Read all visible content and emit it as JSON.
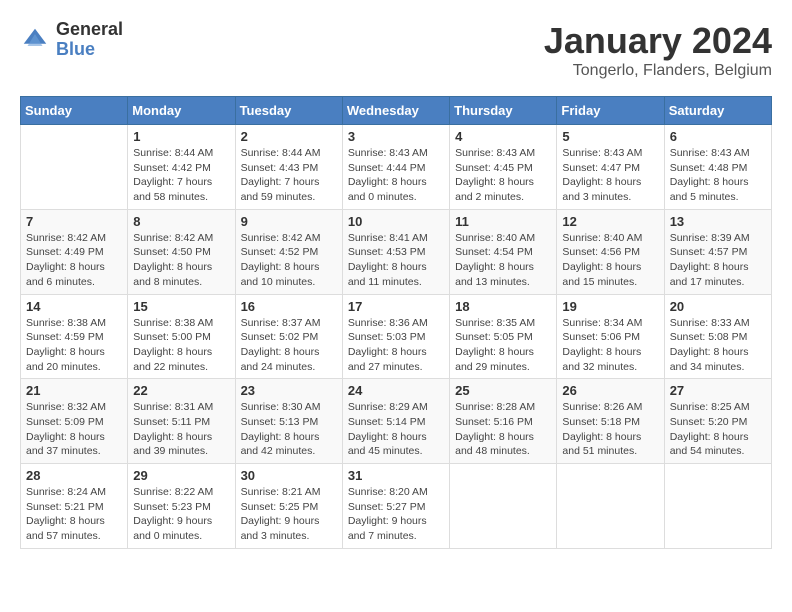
{
  "header": {
    "logo_general": "General",
    "logo_blue": "Blue",
    "month_title": "January 2024",
    "location": "Tongerlo, Flanders, Belgium"
  },
  "days_of_week": [
    "Sunday",
    "Monday",
    "Tuesday",
    "Wednesday",
    "Thursday",
    "Friday",
    "Saturday"
  ],
  "weeks": [
    [
      {
        "day": "",
        "info": ""
      },
      {
        "day": "1",
        "info": "Sunrise: 8:44 AM\nSunset: 4:42 PM\nDaylight: 7 hours\nand 58 minutes."
      },
      {
        "day": "2",
        "info": "Sunrise: 8:44 AM\nSunset: 4:43 PM\nDaylight: 7 hours\nand 59 minutes."
      },
      {
        "day": "3",
        "info": "Sunrise: 8:43 AM\nSunset: 4:44 PM\nDaylight: 8 hours\nand 0 minutes."
      },
      {
        "day": "4",
        "info": "Sunrise: 8:43 AM\nSunset: 4:45 PM\nDaylight: 8 hours\nand 2 minutes."
      },
      {
        "day": "5",
        "info": "Sunrise: 8:43 AM\nSunset: 4:47 PM\nDaylight: 8 hours\nand 3 minutes."
      },
      {
        "day": "6",
        "info": "Sunrise: 8:43 AM\nSunset: 4:48 PM\nDaylight: 8 hours\nand 5 minutes."
      }
    ],
    [
      {
        "day": "7",
        "info": "Sunrise: 8:42 AM\nSunset: 4:49 PM\nDaylight: 8 hours\nand 6 minutes."
      },
      {
        "day": "8",
        "info": "Sunrise: 8:42 AM\nSunset: 4:50 PM\nDaylight: 8 hours\nand 8 minutes."
      },
      {
        "day": "9",
        "info": "Sunrise: 8:42 AM\nSunset: 4:52 PM\nDaylight: 8 hours\nand 10 minutes."
      },
      {
        "day": "10",
        "info": "Sunrise: 8:41 AM\nSunset: 4:53 PM\nDaylight: 8 hours\nand 11 minutes."
      },
      {
        "day": "11",
        "info": "Sunrise: 8:40 AM\nSunset: 4:54 PM\nDaylight: 8 hours\nand 13 minutes."
      },
      {
        "day": "12",
        "info": "Sunrise: 8:40 AM\nSunset: 4:56 PM\nDaylight: 8 hours\nand 15 minutes."
      },
      {
        "day": "13",
        "info": "Sunrise: 8:39 AM\nSunset: 4:57 PM\nDaylight: 8 hours\nand 17 minutes."
      }
    ],
    [
      {
        "day": "14",
        "info": "Sunrise: 8:38 AM\nSunset: 4:59 PM\nDaylight: 8 hours\nand 20 minutes."
      },
      {
        "day": "15",
        "info": "Sunrise: 8:38 AM\nSunset: 5:00 PM\nDaylight: 8 hours\nand 22 minutes."
      },
      {
        "day": "16",
        "info": "Sunrise: 8:37 AM\nSunset: 5:02 PM\nDaylight: 8 hours\nand 24 minutes."
      },
      {
        "day": "17",
        "info": "Sunrise: 8:36 AM\nSunset: 5:03 PM\nDaylight: 8 hours\nand 27 minutes."
      },
      {
        "day": "18",
        "info": "Sunrise: 8:35 AM\nSunset: 5:05 PM\nDaylight: 8 hours\nand 29 minutes."
      },
      {
        "day": "19",
        "info": "Sunrise: 8:34 AM\nSunset: 5:06 PM\nDaylight: 8 hours\nand 32 minutes."
      },
      {
        "day": "20",
        "info": "Sunrise: 8:33 AM\nSunset: 5:08 PM\nDaylight: 8 hours\nand 34 minutes."
      }
    ],
    [
      {
        "day": "21",
        "info": "Sunrise: 8:32 AM\nSunset: 5:09 PM\nDaylight: 8 hours\nand 37 minutes."
      },
      {
        "day": "22",
        "info": "Sunrise: 8:31 AM\nSunset: 5:11 PM\nDaylight: 8 hours\nand 39 minutes."
      },
      {
        "day": "23",
        "info": "Sunrise: 8:30 AM\nSunset: 5:13 PM\nDaylight: 8 hours\nand 42 minutes."
      },
      {
        "day": "24",
        "info": "Sunrise: 8:29 AM\nSunset: 5:14 PM\nDaylight: 8 hours\nand 45 minutes."
      },
      {
        "day": "25",
        "info": "Sunrise: 8:28 AM\nSunset: 5:16 PM\nDaylight: 8 hours\nand 48 minutes."
      },
      {
        "day": "26",
        "info": "Sunrise: 8:26 AM\nSunset: 5:18 PM\nDaylight: 8 hours\nand 51 minutes."
      },
      {
        "day": "27",
        "info": "Sunrise: 8:25 AM\nSunset: 5:20 PM\nDaylight: 8 hours\nand 54 minutes."
      }
    ],
    [
      {
        "day": "28",
        "info": "Sunrise: 8:24 AM\nSunset: 5:21 PM\nDaylight: 8 hours\nand 57 minutes."
      },
      {
        "day": "29",
        "info": "Sunrise: 8:22 AM\nSunset: 5:23 PM\nDaylight: 9 hours\nand 0 minutes."
      },
      {
        "day": "30",
        "info": "Sunrise: 8:21 AM\nSunset: 5:25 PM\nDaylight: 9 hours\nand 3 minutes."
      },
      {
        "day": "31",
        "info": "Sunrise: 8:20 AM\nSunset: 5:27 PM\nDaylight: 9 hours\nand 7 minutes."
      },
      {
        "day": "",
        "info": ""
      },
      {
        "day": "",
        "info": ""
      },
      {
        "day": "",
        "info": ""
      }
    ]
  ]
}
